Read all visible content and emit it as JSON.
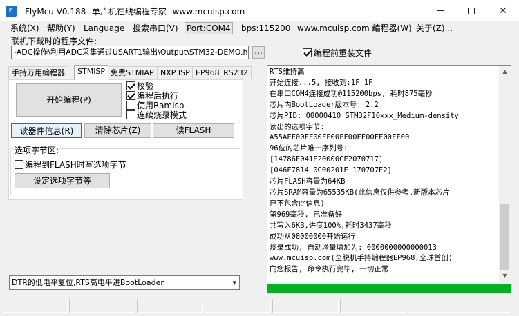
{
  "window": {
    "title": "FlyMcu V0.188--单片机在线编程专家--www.mcuisp.com",
    "app_icon": "flymcu-app-icon",
    "controls": {
      "minimize": "minimize-icon",
      "maximize": "maximize-icon",
      "close": "✕"
    }
  },
  "menu": {
    "items": [
      "系统(X)",
      "帮助(Y)",
      "Language",
      "搜索串口(V)",
      "Port:COM4",
      "bps:115200",
      "www.mcuisp.com 编程器(W)",
      "关于(Z)..."
    ]
  },
  "file": {
    "label": "联机下载时的程序文件:",
    "path": "-ADC操作\\利用ADC采集通过USART1输出\\Output\\STM32-DEMO.hex",
    "browse": "...",
    "reload_label": "编程前重装文件",
    "reload_checked": true
  },
  "tabs": [
    "手持万用编程器",
    "STMISP",
    "免费STMIAP",
    "NXP ISP",
    "EP968_RS232"
  ],
  "active_tab": "STMISP",
  "stmisp": {
    "start_button": "开始编程(P)",
    "options": [
      {
        "label": "校验",
        "checked": true
      },
      {
        "label": "编程后执行",
        "checked": true
      },
      {
        "label": "使用RamIsp",
        "checked": false
      },
      {
        "label": "连续烧录模式",
        "checked": false
      }
    ],
    "read_info_button": "读器件信息(R)",
    "erase_button": "清除芯片(Z)",
    "read_flash_button": "读FLASH",
    "option_bytes": {
      "title": "选项字节区:",
      "write_to_flash_label": "编程到FLASH时写选项字节",
      "write_to_flash_checked": false,
      "set_button": "设定选项字节等"
    }
  },
  "reset_mode": {
    "selected": "DTR的低电平复位,RTS高电平进BootLoader",
    "arrow": "chevron-down-icon"
  },
  "log": {
    "lines": [
      "RTS维持高",
      "开始连接...5, 接收到:1F 1F",
      "在串口COM4连接成功@115200bps, 耗时875毫秒",
      "芯片内BootLoader版本号: 2.2",
      "芯片PID: 00000410  STM32F10xxx_Medium-density",
      "读出的选项字节:",
      "A55AFF00FF00FF00FF00FF00FF00FF00",
      "96位的芯片唯一序列号:",
      "[14786F041E20000CE2070717]",
      "[046F7814 0C00201E 170707E2]",
      "芯片FLASH容量为64KB",
      "芯片SRAM容量为65535KB(此信息仅供参考,新版本芯片",
      "已不包含此信息)",
      "第969毫秒, 已准备好",
      "共写入6KB,进度100%,耗时3437毫秒",
      "成功从08000000开始运行",
      "烧录成功, 自动增量增加为: 0000000000000013",
      "www.mcuisp.com(全脱机手持编程器EP968,全球首创)",
      "向您报告, 命令执行完毕, 一切正常"
    ]
  },
  "progress": {
    "value_percent": 100,
    "color": "#06b025"
  }
}
